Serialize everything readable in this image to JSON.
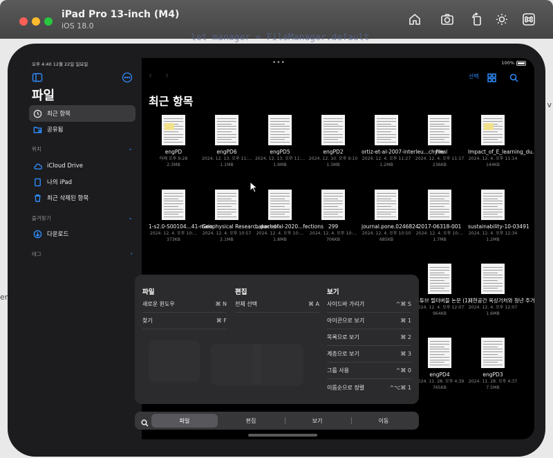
{
  "simulator": {
    "title": "iPad Pro 13-inch (M4)",
    "subtitle": "iOS 18.0",
    "icons": [
      "home-icon",
      "screenshot-icon",
      "rotate-icon",
      "brightness-icon",
      "command-icon"
    ]
  },
  "background": {
    "code_text": "let manager = FileManager.default",
    "left_edge_text": "en",
    "right_edge_text": "v"
  },
  "status_bar": {
    "time": "오후 4:40  12월 22일 일요일",
    "dots": "•••",
    "battery": "100%"
  },
  "sidebar": {
    "title": "파일",
    "items": [
      {
        "label": "최근 항목",
        "icon": "clock-icon",
        "active": true
      },
      {
        "label": "공유됨",
        "icon": "shared-folder-icon",
        "active": false
      }
    ],
    "sections": [
      {
        "label": "위치",
        "items": [
          {
            "label": "iCloud Drive",
            "icon": "cloud-icon"
          },
          {
            "label": "나의 iPad",
            "icon": "ipad-icon"
          },
          {
            "label": "최근 삭제된 항목",
            "icon": "trash-icon"
          }
        ]
      },
      {
        "label": "즐겨찾기",
        "items": [
          {
            "label": "다운로드",
            "icon": "download-icon"
          }
        ]
      },
      {
        "label": "태그",
        "items": []
      }
    ]
  },
  "toolbar": {
    "select_label": "선택",
    "icons": [
      "grid-icon",
      "search-icon"
    ]
  },
  "main": {
    "title": "최근 항목",
    "files": [
      {
        "name": "engPD",
        "date": "어제 오후 9:28",
        "size": "2.3MB"
      },
      {
        "name": "engPD6",
        "date": "2024. 12. 13. 오후 11:...",
        "size": "1.1MB"
      },
      {
        "name": "engPD5",
        "date": "2024. 12. 13. 오후 11:...",
        "size": "1.9MB"
      },
      {
        "name": "engPD2",
        "date": "2024. 12. 10. 오후 9:10",
        "size": "1.3MB"
      },
      {
        "name": "ortiz-et-al-2007-interleu...chymal",
        "date": "2024. 12. 4. 오후 11:27",
        "size": "1.2MB"
      },
      {
        "name": "file",
        "date": "2024. 12. 4. 오후 11:17",
        "size": "236KB"
      },
      {
        "name": "Impact_of_E_learning_du...19_Pan",
        "date": "2024. 12. 4. 오후 11:14",
        "size": "144KB"
      },
      {
        "name": "1-s2.0-S00104...41-main",
        "date": "2024. 12. 4. 오후 10:...",
        "size": "373KB"
      },
      {
        "name": "Geophysical Researc...pact of",
        "date": "2024. 12. 4. 오후 10:57",
        "size": "2.1MB"
      },
      {
        "name": "baker-et-al-2020...fections",
        "date": "2024. 12. 4. 오후 10:...",
        "size": "1.8MB"
      },
      {
        "name": "299",
        "date": "2024. 12. 4. 오후 10:...",
        "size": "706KB"
      },
      {
        "name": "journal.pone.0246824",
        "date": "2024. 12. 4. 오후 10:50",
        "size": "685KB"
      },
      {
        "name": "2017-06318-001",
        "date": "2024. 12. 4. 오후 10:...",
        "size": "1.7MB"
      },
      {
        "name": "sustainability-10-03491",
        "date": "2024. 12. 4. 오후 12:34",
        "size": "1.2MB"
      },
      {
        "name": "유튜브 필터버블 논문 (1)",
        "date": "2024. 12. 4. 오후 12:07",
        "size": "964KB"
      },
      {
        "name": "재현공간 옥상거처와 청년 주거 의미",
        "date": "2024. 12. 4. 오후 12:07",
        "size": "1.6MB"
      },
      {
        "name": "engPD4",
        "date": "2024. 11. 28. 오후 4:39",
        "size": "765KB"
      },
      {
        "name": "engPD3",
        "date": "2024. 11. 28. 오후 4:37",
        "size": "7.5MB"
      }
    ]
  },
  "menu": {
    "columns": [
      {
        "title": "파일",
        "items": [
          {
            "label": "새로운 윈도우",
            "shortcut": "⌘ N"
          },
          {
            "label": "찾기",
            "shortcut": "⌘ F"
          }
        ]
      },
      {
        "title": "편집",
        "items": [
          {
            "label": "전체 선택",
            "shortcut": "⌘ A"
          }
        ]
      },
      {
        "title": "보기",
        "items": [
          {
            "label": "사이드바 가리기",
            "shortcut": "^⌘ S"
          },
          {
            "label": "아이콘으로 보기",
            "shortcut": "⌘ 1"
          },
          {
            "label": "목록으로 보기",
            "shortcut": "⌘ 2"
          },
          {
            "label": "계층으로 보기",
            "shortcut": "⌘ 3"
          },
          {
            "label": "그룹 사용",
            "shortcut": "^⌘ 0"
          },
          {
            "label": "이름순으로 정렬",
            "shortcut": "^⌥⌘ 1"
          }
        ]
      }
    ]
  },
  "tabbar": {
    "tabs": [
      {
        "label": "파일",
        "active": true
      },
      {
        "label": "편집",
        "active": false
      },
      {
        "label": "보기",
        "active": false
      },
      {
        "label": "이동",
        "active": false
      }
    ]
  }
}
